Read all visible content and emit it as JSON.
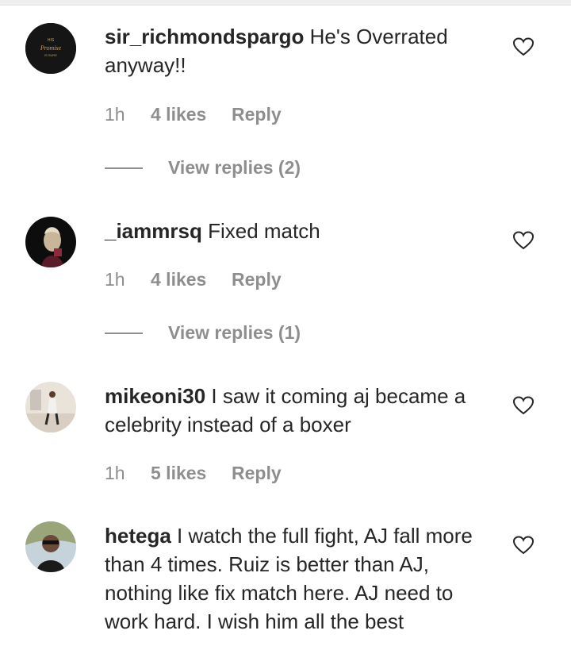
{
  "comments": [
    {
      "username": "sir_richmondspargo",
      "text": "He's Overrated anyway!!",
      "avatar_text": {
        "top": "HIS",
        "middle": "Promise",
        "bottom": "IS SURE"
      },
      "time": "1h",
      "likes": "4 likes",
      "reply": "Reply",
      "view_replies": "View replies (2)"
    },
    {
      "username": "_iammrsq",
      "text": "Fixed match",
      "time": "1h",
      "likes": "4 likes",
      "reply": "Reply",
      "view_replies": "View replies (1)"
    },
    {
      "username": "mikeoni30",
      "text": "I saw it coming aj became a celebrity instead of a boxer",
      "time": "1h",
      "likes": "5 likes",
      "reply": "Reply"
    },
    {
      "username": "hetega",
      "text": "I watch the full fight, AJ fall more than 4 times. Ruiz is better than AJ, nothing like fix match here. AJ need to work hard. I wish him all the best"
    }
  ],
  "colors": {
    "text": "#262626",
    "muted": "#8e8e8e"
  },
  "icons": {
    "like": "heart-outline-icon"
  }
}
